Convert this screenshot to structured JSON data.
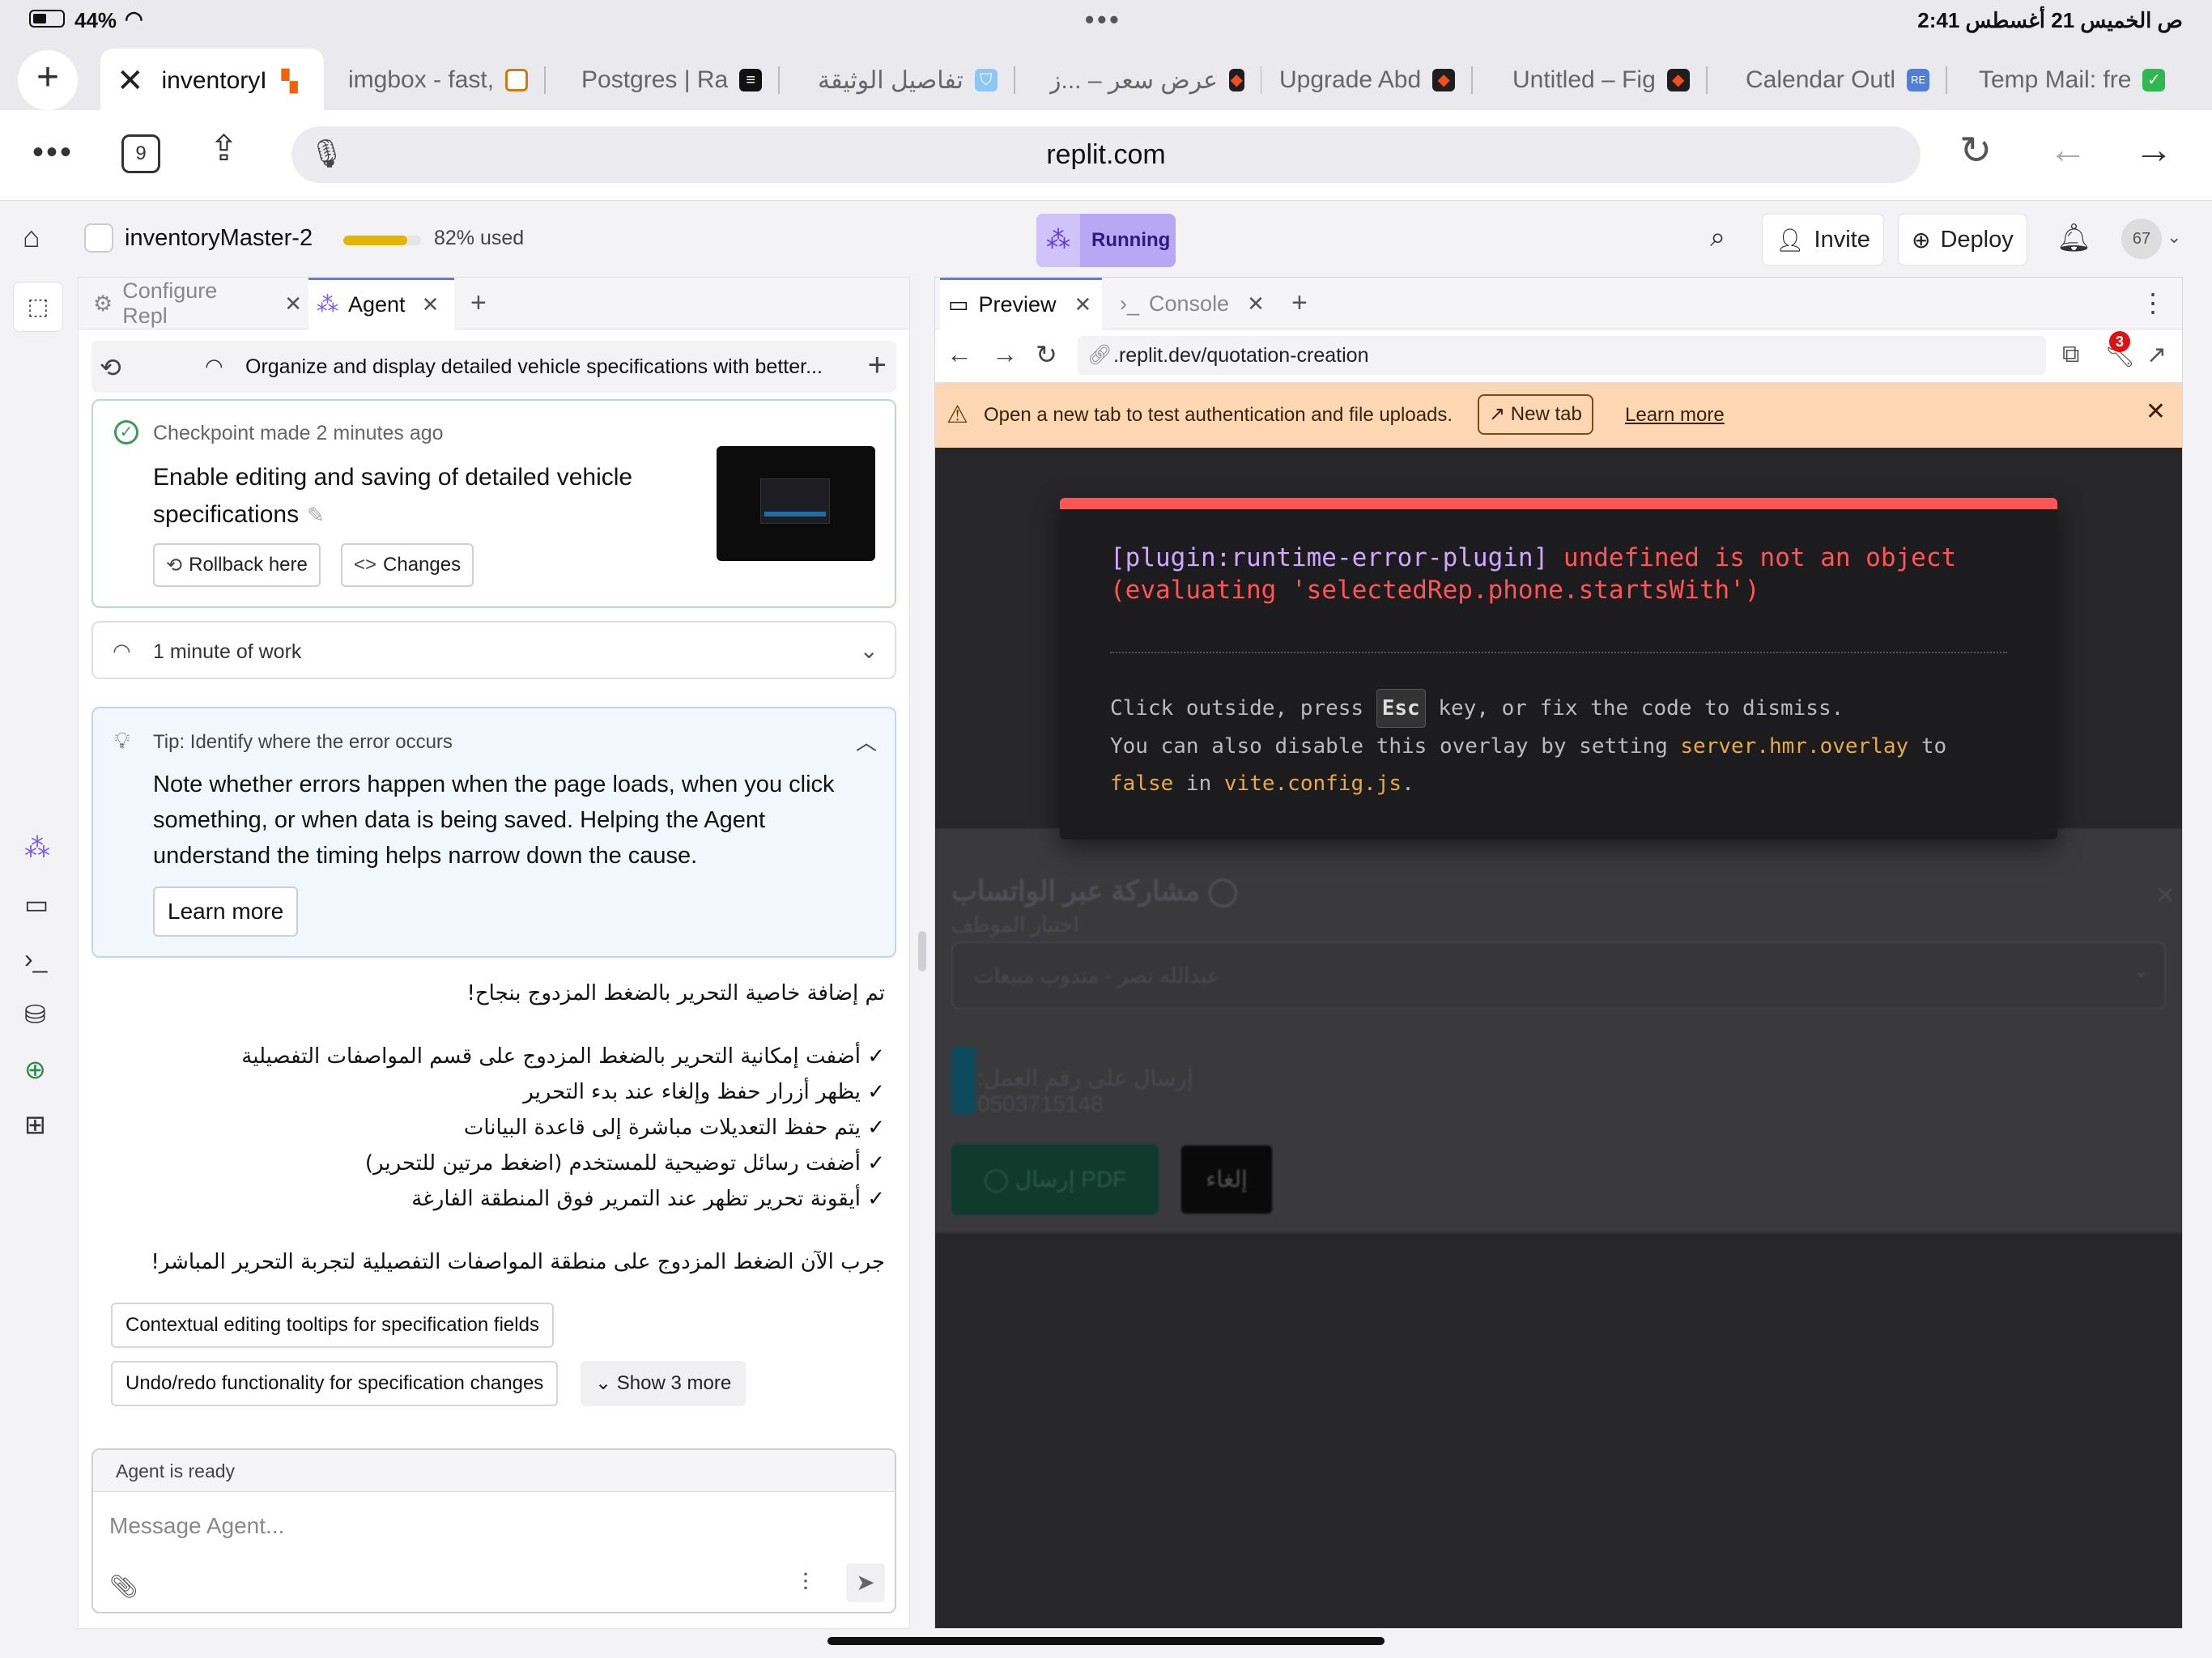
{
  "status_bar": {
    "battery": "44%",
    "time": "2:41 ص الخميس 21 أغسطس"
  },
  "browser_tabs": [
    {
      "title": "inventoryI",
      "active": true,
      "icon": "replit-icon",
      "icon_color": "#f26207"
    },
    {
      "title": "imgbox - fast,",
      "icon": "imgbox-icon",
      "icon_color": "#e0931a"
    },
    {
      "title": "Postgres | Ra",
      "icon": "railway-icon",
      "icon_color": "#111111"
    },
    {
      "title": "تفاصيل الوثيقة",
      "icon": "shield-icon",
      "icon_color": "#6bb3f0"
    },
    {
      "title": "عرض سعر – ...ز",
      "icon": "figma-icon",
      "icon_color": "#1e1e1e"
    },
    {
      "title": "Upgrade Abd",
      "icon": "figma-icon",
      "icon_color": "#1e1e1e"
    },
    {
      "title": "Untitled – Fig",
      "icon": "figma-icon",
      "icon_color": "#1e1e1e"
    },
    {
      "title": "Calendar Outl",
      "icon": "repo-icon",
      "icon_color": "#4f7fd9"
    },
    {
      "title": "Temp Mail: fre",
      "icon": "shield-check-icon",
      "icon_color": "#2eb84f"
    }
  ],
  "address_bar": {
    "tab_count": "9",
    "url": "replit.com"
  },
  "replit_header": {
    "repl_name": "inventoryMaster-2",
    "usage_fraction": 0.82,
    "usage_label": "82% used",
    "status": "Running",
    "invite_label": "Invite",
    "deploy_label": "Deploy",
    "avatar_label": "67"
  },
  "left_tabs": {
    "configure": "Configure Repl",
    "agent": "Agent"
  },
  "thread": {
    "title": "Organize and display detailed vehicle specifications with better..."
  },
  "checkpoint": {
    "meta_label": "Checkpoint made",
    "time": "2 minutes ago",
    "title": "Enable editing and saving of detailed vehicle specifications",
    "rollback_label": "Rollback here",
    "changes_label": "Changes"
  },
  "work": {
    "label": "1 minute of work"
  },
  "tip": {
    "title": "Tip: Identify where the error occurs",
    "body": "Note whether errors happen when the page loads, when you click something, or when data is being saved. Helping the Agent understand the timing helps narrow down the cause.",
    "button": "Learn more"
  },
  "agent_message": {
    "intro": "تم إضافة خاصية التحرير بالضغط المزدوج بنجاح!",
    "items": [
      "أضفت إمكانية التحرير بالضغط المزدوج على قسم المواصفات التفصيلية",
      "يظهر أزرار حفظ وإلغاء عند بدء التحرير",
      "يتم حفظ التعديلات مباشرة إلى قاعدة البيانات",
      "أضفت رسائل توضيحية للمستخدم (اضغط مرتين للتحرير)",
      "أيقونة تحرير تظهر عند التمرير فوق المنطقة الفارغة"
    ],
    "outro": "جرب الآن الضغط المزدوج على منطقة المواصفات التفصيلية لتجربة التحرير المباشر!"
  },
  "suggestions": {
    "s1": "Contextual editing tooltips for specification fields",
    "s2": "Undo/redo functionality for specification changes",
    "show_more": "Show 3 more"
  },
  "composer": {
    "status": "Agent is ready",
    "placeholder": "Message Agent..."
  },
  "right_tabs": {
    "preview": "Preview",
    "console": "Console"
  },
  "preview_bar": {
    "url_prefix": ".replit.dev",
    "url_path": "/quotation-creation",
    "badge_count": "3"
  },
  "warning": {
    "text": "Open a new tab to test authentication and file uploads.",
    "new_tab": "New tab",
    "learn_more": "Learn more"
  },
  "error_overlay": {
    "plugin": "[plugin:runtime-error-plugin]",
    "message_1": " undefined is not an object",
    "message_2": "(evaluating 'selectedRep.phone.startsWith')",
    "hint_1a": "Click outside, press ",
    "hint_key": "Esc",
    "hint_1b": " key, or fix the code to dismiss.",
    "hint_2": "You can also disable this overlay by setting ",
    "hint_setting": "server.hmr.overlay",
    "hint_2b": " to",
    "hint_false": "false",
    "hint_3": " in ",
    "hint_file": "vite.config.js",
    "hint_end": "."
  },
  "background_modal": {
    "title": "مشاركة عبر الواتساب",
    "employee_label": "اختيار الموظف",
    "selected_employee": "عبدالله نصر - مندوب مبيعات",
    "phone_text": "إرسال على رقم العمل: 0503715148",
    "send_pdf": "إرسال PDF",
    "cancel": "إلغاء"
  }
}
